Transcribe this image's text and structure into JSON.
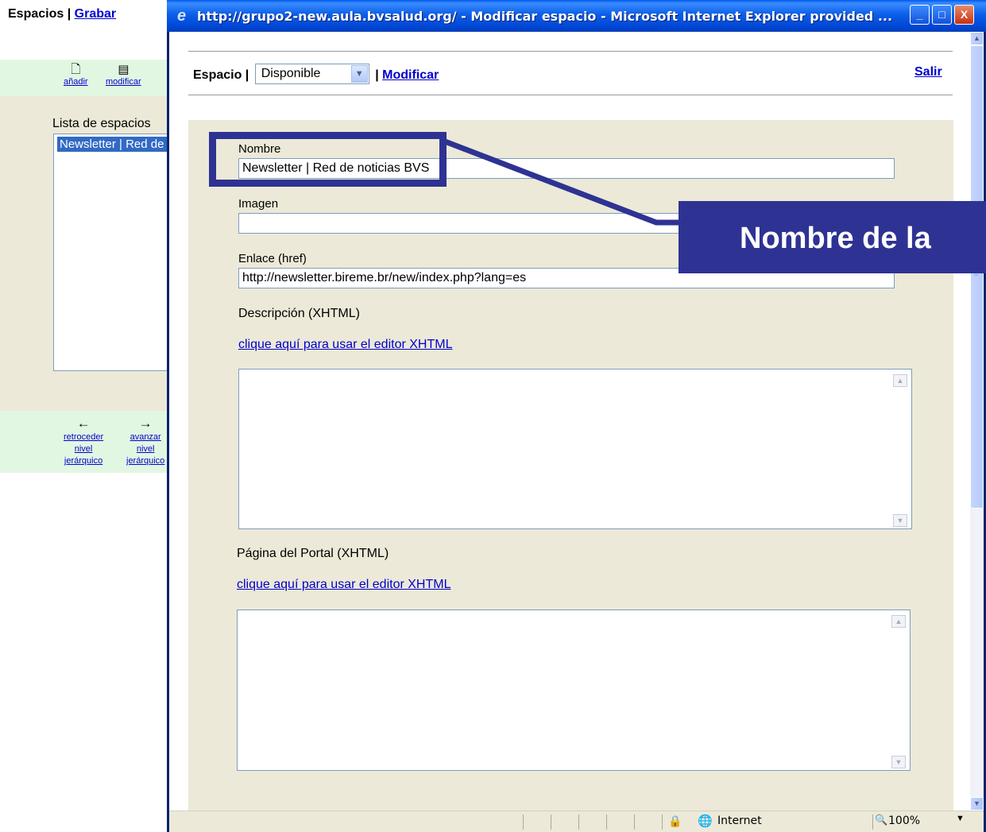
{
  "background_page": {
    "header": {
      "title": "Espacios",
      "separator": "|",
      "save_link": "Grabar"
    },
    "toolbar": {
      "add_label": "añadir",
      "modify_label": "modificar"
    },
    "list": {
      "label": "Lista de espacios",
      "selected_item": "Newsletter | Red de noticias BVS"
    },
    "nav": {
      "back_label_1": "retroceder",
      "back_label_2": "nivel",
      "back_label_3": "jerárquico",
      "forward_label_1": "avanzar",
      "forward_label_2": "nivel",
      "forward_label_3": "jerárquico"
    }
  },
  "window": {
    "title": "http://grupo2-new.aula.bvsalud.org/ - Modificar espacio - Microsoft Internet Explorer provided ...",
    "minimize": "_",
    "maximize": "□",
    "close": "X"
  },
  "form_nav": {
    "space_label": "Espacio |",
    "status_value": "Disponible",
    "separator": "|",
    "modify_link": "Modificar",
    "exit_link": "Salir"
  },
  "form": {
    "name_label": "Nombre",
    "name_value": "Newsletter | Red de noticias BVS",
    "image_label": "Imagen",
    "image_value": "",
    "link_label": "Enlace (href)",
    "link_value": "http://newsletter.bireme.br/new/index.php?lang=es",
    "description_label": "Descripción (XHTML)",
    "description_editor_link": "clique aquí para usar el editor XHTML",
    "portal_page_label": "Página del Portal (XHTML)",
    "portal_editor_link": "clique aquí para usar el editor XHTML"
  },
  "status_bar": {
    "zone": "Internet",
    "zoom": "100%"
  },
  "callout": {
    "text": "Nombre de la"
  },
  "colors": {
    "annotation": "#2e3393",
    "panel": "#ece9d8",
    "toolbar_green": "#e2f7e2",
    "link": "#0000cc"
  }
}
